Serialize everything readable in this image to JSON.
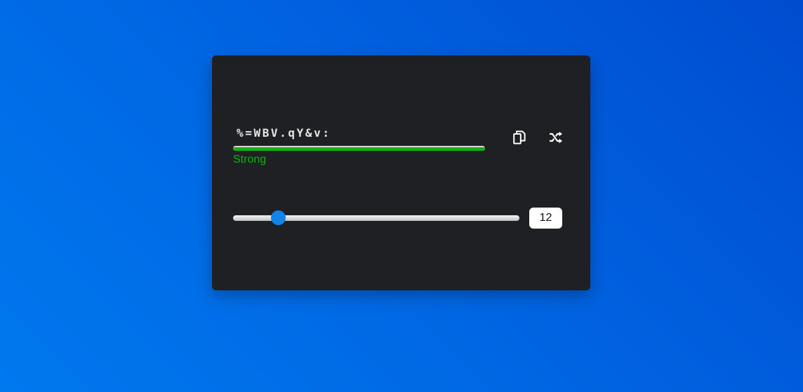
{
  "generator": {
    "password": "%=WBV.qY&v:",
    "strength": {
      "label": "Strong",
      "level": 1.0,
      "color": "#10b40f"
    },
    "length": {
      "value": "12",
      "min": 4,
      "max": 64
    }
  },
  "icons": {
    "copy": "copy-icon",
    "shuffle": "shuffle-icon"
  },
  "colors": {
    "accent": "#1284e8",
    "card": "#1f2023",
    "strong": "#0fb30f"
  }
}
